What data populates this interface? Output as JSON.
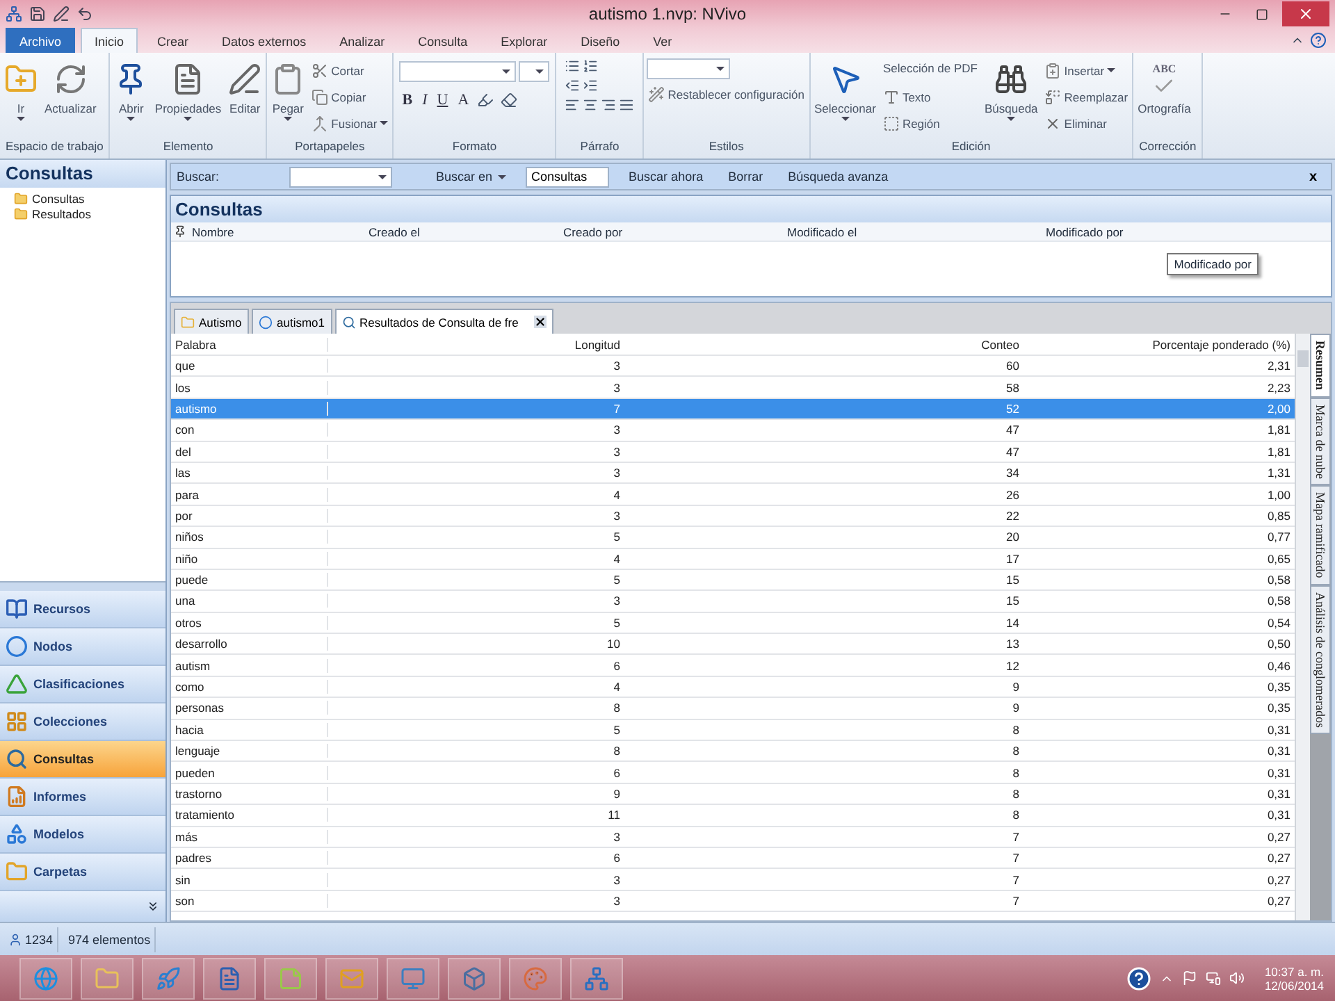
{
  "window": {
    "title": "autismo 1.nvp: NVivo"
  },
  "ribbon_tabs": [
    {
      "label": "Archivo",
      "kind": "file",
      "selected": false
    },
    {
      "label": "Inicio",
      "kind": "tab",
      "selected": true
    },
    {
      "label": "Crear",
      "kind": "tab",
      "selected": false
    },
    {
      "label": "Datos externos",
      "kind": "tab",
      "selected": false
    },
    {
      "label": "Analizar",
      "kind": "tab",
      "selected": false
    },
    {
      "label": "Consulta",
      "kind": "tab",
      "selected": false
    },
    {
      "label": "Explorar",
      "kind": "tab",
      "selected": false
    },
    {
      "label": "Diseño",
      "kind": "tab",
      "selected": false
    },
    {
      "label": "Ver",
      "kind": "tab",
      "selected": false
    }
  ],
  "ribbon_groups": [
    {
      "label": "Espacio de trabajo",
      "items": [
        {
          "kind": "large",
          "label": "Ir",
          "caret": true
        },
        {
          "kind": "large",
          "label": "Actualizar",
          "caret": false
        }
      ]
    },
    {
      "label": "Elemento",
      "items": [
        {
          "kind": "large",
          "label": "Abrir",
          "caret": true
        },
        {
          "kind": "large",
          "label": "Propiedades",
          "caret": true
        },
        {
          "kind": "large",
          "label": "Editar",
          "caret": false
        }
      ]
    },
    {
      "label": "Portapapeles",
      "items": [
        {
          "kind": "large",
          "label": "Pegar",
          "caret": true
        },
        {
          "kind": "small",
          "label": "Cortar",
          "caret": false
        },
        {
          "kind": "small",
          "label": "Copiar",
          "caret": false
        },
        {
          "kind": "small",
          "label": "Fusionar",
          "caret": true
        }
      ]
    },
    {
      "label": "Formato",
      "items": [
        {
          "kind": "format",
          "buttons": [
            "B",
            "I",
            "U",
            "A"
          ]
        }
      ]
    },
    {
      "label": "Párrafo",
      "items": [
        {
          "kind": "paragraph"
        }
      ]
    },
    {
      "label": "Estilos",
      "items": [
        {
          "kind": "combo"
        },
        {
          "kind": "small",
          "label": "Restablecer configuración",
          "caret": false
        }
      ]
    },
    {
      "label": "Edición",
      "items": [
        {
          "kind": "large",
          "label": "Seleccionar",
          "caret": true
        },
        {
          "kind": "label",
          "label": "Selección de PDF"
        },
        {
          "kind": "small",
          "label": "Texto",
          "caret": false
        },
        {
          "kind": "small",
          "label": "Región",
          "caret": false
        },
        {
          "kind": "large",
          "label": "Búsqueda",
          "caret": true
        },
        {
          "kind": "small",
          "label": "Insertar",
          "caret": true
        },
        {
          "kind": "small",
          "label": "Reemplazar",
          "caret": false
        },
        {
          "kind": "small",
          "label": "Eliminar",
          "caret": false
        }
      ]
    },
    {
      "label": "Corrección",
      "items": [
        {
          "kind": "large",
          "label": "Ortografía",
          "caret": false,
          "icon_text": "ABC"
        }
      ]
    }
  ],
  "sidebar": {
    "title": "Consultas",
    "tree": [
      {
        "label": "Consultas"
      },
      {
        "label": "Resultados"
      }
    ],
    "nav": [
      {
        "label": "Recursos",
        "selected": false
      },
      {
        "label": "Nodos",
        "selected": false
      },
      {
        "label": "Clasificaciones",
        "selected": false
      },
      {
        "label": "Colecciones",
        "selected": false
      },
      {
        "label": "Consultas",
        "selected": true
      },
      {
        "label": "Informes",
        "selected": false
      },
      {
        "label": "Modelos",
        "selected": false
      },
      {
        "label": "Carpetas",
        "selected": false
      }
    ]
  },
  "search_bar": {
    "label": "Buscar:",
    "scope_label": "Buscar en",
    "scope_value": "Consultas",
    "buttons": [
      "Buscar ahora",
      "Borrar",
      "Búsqueda avanza"
    ],
    "close": "x"
  },
  "queries_panel": {
    "title": "Consultas",
    "columns": [
      "Nombre",
      "Creado el",
      "Creado por",
      "Modificado el",
      "Modificado por"
    ],
    "tooltip": "Modificado por"
  },
  "doc_tabs": [
    {
      "label": "Autismo",
      "selected": false,
      "kind": "folder"
    },
    {
      "label": "autismo1",
      "selected": false,
      "kind": "node"
    },
    {
      "label": "Resultados de Consulta de fre",
      "selected": true,
      "kind": "query"
    }
  ],
  "table": {
    "columns": [
      "Palabra",
      "Longitud",
      "Conteo",
      "Porcentaje ponderado (%)"
    ],
    "rows": [
      {
        "cells": [
          "que",
          "3",
          "60",
          "2,31"
        ],
        "selected": false
      },
      {
        "cells": [
          "los",
          "3",
          "58",
          "2,23"
        ],
        "selected": false
      },
      {
        "cells": [
          "autismo",
          "7",
          "52",
          "2,00"
        ],
        "selected": true
      },
      {
        "cells": [
          "con",
          "3",
          "47",
          "1,81"
        ],
        "selected": false
      },
      {
        "cells": [
          "del",
          "3",
          "47",
          "1,81"
        ],
        "selected": false
      },
      {
        "cells": [
          "las",
          "3",
          "34",
          "1,31"
        ],
        "selected": false
      },
      {
        "cells": [
          "para",
          "4",
          "26",
          "1,00"
        ],
        "selected": false
      },
      {
        "cells": [
          "por",
          "3",
          "22",
          "0,85"
        ],
        "selected": false
      },
      {
        "cells": [
          "niños",
          "5",
          "20",
          "0,77"
        ],
        "selected": false
      },
      {
        "cells": [
          "niño",
          "4",
          "17",
          "0,65"
        ],
        "selected": false
      },
      {
        "cells": [
          "puede",
          "5",
          "15",
          "0,58"
        ],
        "selected": false
      },
      {
        "cells": [
          "una",
          "3",
          "15",
          "0,58"
        ],
        "selected": false
      },
      {
        "cells": [
          "otros",
          "5",
          "14",
          "0,54"
        ],
        "selected": false
      },
      {
        "cells": [
          "desarrollo",
          "10",
          "13",
          "0,50"
        ],
        "selected": false
      },
      {
        "cells": [
          "autism",
          "6",
          "12",
          "0,46"
        ],
        "selected": false
      },
      {
        "cells": [
          "como",
          "4",
          "9",
          "0,35"
        ],
        "selected": false
      },
      {
        "cells": [
          "personas",
          "8",
          "9",
          "0,35"
        ],
        "selected": false
      },
      {
        "cells": [
          "hacia",
          "5",
          "8",
          "0,31"
        ],
        "selected": false
      },
      {
        "cells": [
          "lenguaje",
          "8",
          "8",
          "0,31"
        ],
        "selected": false
      },
      {
        "cells": [
          "pueden",
          "6",
          "8",
          "0,31"
        ],
        "selected": false
      },
      {
        "cells": [
          "trastorno",
          "9",
          "8",
          "0,31"
        ],
        "selected": false
      },
      {
        "cells": [
          "tratamiento",
          "11",
          "8",
          "0,31"
        ],
        "selected": false
      },
      {
        "cells": [
          "más",
          "3",
          "7",
          "0,27"
        ],
        "selected": false
      },
      {
        "cells": [
          "padres",
          "6",
          "7",
          "0,27"
        ],
        "selected": false
      },
      {
        "cells": [
          "sin",
          "3",
          "7",
          "0,27"
        ],
        "selected": false
      },
      {
        "cells": [
          "son",
          "3",
          "7",
          "0,27"
        ],
        "selected": false
      }
    ]
  },
  "side_tabs": [
    {
      "label": "Resumen",
      "selected": true
    },
    {
      "label": "Marca de nube",
      "selected": false
    },
    {
      "label": "Mapa ramificado",
      "selected": false
    },
    {
      "label": "Análisis de conglomerados",
      "selected": false
    }
  ],
  "status_bar": {
    "user": "1234",
    "items": "974 elementos"
  },
  "taskbar": {
    "time": "10:37 a. m.",
    "date": "12/06/2014"
  }
}
